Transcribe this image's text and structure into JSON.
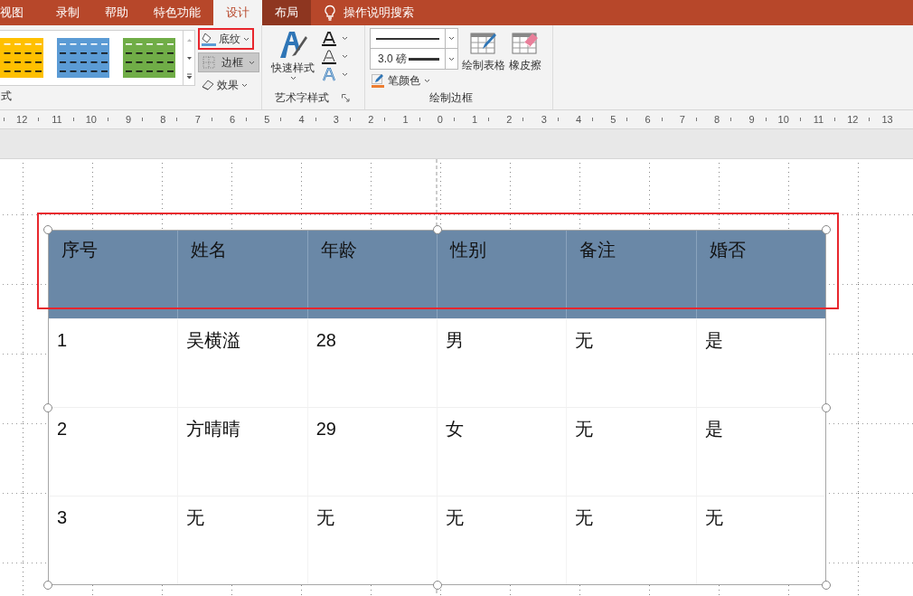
{
  "tabs": [
    {
      "label": "视图",
      "selected": false,
      "kind": "normal"
    },
    {
      "label": "录制",
      "selected": false,
      "kind": "normal"
    },
    {
      "label": "帮助",
      "selected": false,
      "kind": "normal"
    },
    {
      "label": "特色功能",
      "selected": false,
      "kind": "normal"
    },
    {
      "label": "设计",
      "selected": true,
      "kind": "normal"
    },
    {
      "label": "布局",
      "selected": false,
      "kind": "contextual"
    }
  ],
  "search": {
    "label": "操作说明搜索"
  },
  "ribbon": {
    "table_styles": {
      "swatches": [
        {
          "color": "#ffc000"
        },
        {
          "color": "#5b9bd5"
        },
        {
          "color": "#70ad47"
        }
      ],
      "label": "式"
    },
    "shading_button": {
      "label": "底纹",
      "highlighted": true
    },
    "border_button": {
      "label": "边框",
      "selected": true
    },
    "effects_button": {
      "label": "效果"
    },
    "wordart": {
      "quick_styles": "快速样式",
      "label": "艺术字样式"
    },
    "draw_borders": {
      "pen_weight": "3.0 磅",
      "pen_color": "笔颜色",
      "draw_table": "绘制表格",
      "eraser": "橡皮擦",
      "label": "绘制边框"
    }
  },
  "ruler": {
    "labels": [
      "12",
      "11",
      "10",
      "9",
      "8",
      "7",
      "6",
      "5",
      "4",
      "3",
      "2",
      "1",
      "0",
      "1",
      "2",
      "3",
      "4",
      "5",
      "6",
      "7",
      "8",
      "9",
      "10",
      "11",
      "12",
      "13"
    ]
  },
  "table": {
    "header_highlighted": true,
    "columns": [
      "序号",
      "姓名",
      "年龄",
      "性别",
      "备注",
      "婚否"
    ],
    "rows": [
      [
        "1",
        "吴横溢",
        "28",
        "男",
        "无",
        "是"
      ],
      [
        "2",
        "方晴晴",
        "29",
        "女",
        "无",
        "是"
      ],
      [
        "3",
        "无",
        "无",
        "无",
        "无",
        "无"
      ]
    ]
  }
}
